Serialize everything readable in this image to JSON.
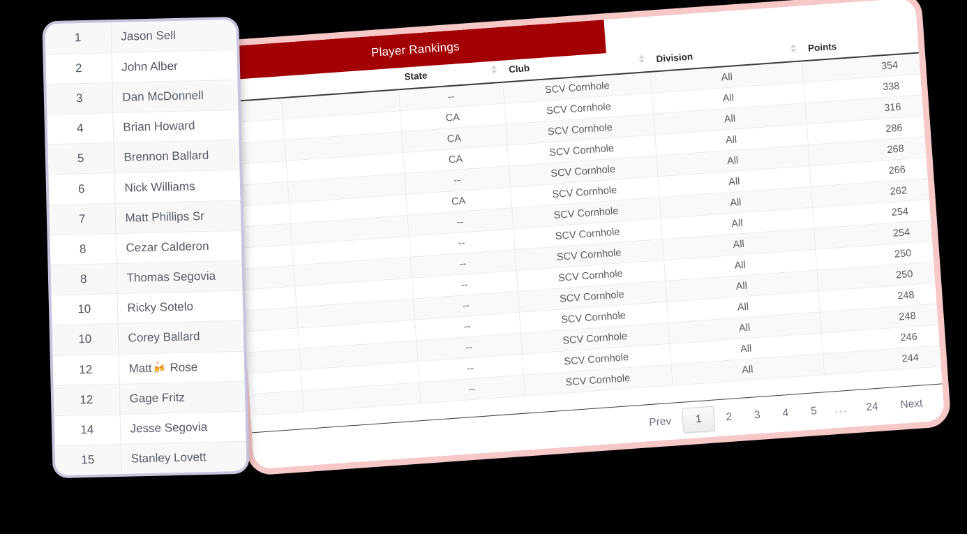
{
  "card": {
    "banner_title": "Player Rankings",
    "banner_color": "#a30004",
    "border_color": "#f7c8c8"
  },
  "table": {
    "headers": [
      {
        "key": "rank",
        "label": ""
      },
      {
        "key": "name",
        "label": ""
      },
      {
        "key": "state",
        "label": "State"
      },
      {
        "key": "club",
        "label": "Club"
      },
      {
        "key": "division",
        "label": "Division"
      },
      {
        "key": "points",
        "label": "Points"
      },
      {
        "key": "actions",
        "label": ""
      }
    ],
    "rows": [
      {
        "state": "--",
        "club": "SCV Cornhole",
        "division": "All",
        "points": "354",
        "action_icon": "tasks-icon"
      },
      {
        "state": "CA",
        "club": "SCV Cornhole",
        "division": "All",
        "points": "338",
        "action_icon": "tasks-icon"
      },
      {
        "state": "CA",
        "club": "SCV Cornhole",
        "division": "All",
        "points": "316",
        "action_icon": "tasks-icon"
      },
      {
        "state": "CA",
        "club": "SCV Cornhole",
        "division": "All",
        "points": "286",
        "action_icon": "tasks-icon"
      },
      {
        "state": "--",
        "club": "SCV Cornhole",
        "division": "All",
        "points": "268",
        "action_icon": "tasks-icon"
      },
      {
        "state": "CA",
        "club": "SCV Cornhole",
        "division": "All",
        "points": "266",
        "action_icon": "tasks-icon"
      },
      {
        "state": "--",
        "club": "SCV Cornhole",
        "division": "All",
        "points": "262",
        "action_icon": "tasks-icon"
      },
      {
        "state": "--",
        "club": "SCV Cornhole",
        "division": "All",
        "points": "254",
        "action_icon": "tasks-icon"
      },
      {
        "state": "--",
        "club": "SCV Cornhole",
        "division": "All",
        "points": "254",
        "action_icon": "tasks-icon"
      },
      {
        "state": "--",
        "club": "SCV Cornhole",
        "division": "All",
        "points": "250",
        "action_icon": "tasks-icon"
      },
      {
        "state": "--",
        "club": "SCV Cornhole",
        "division": "All",
        "points": "250",
        "action_icon": "tasks-icon"
      },
      {
        "state": "--",
        "club": "SCV Cornhole",
        "division": "All",
        "points": "248",
        "action_icon": "tasks-icon"
      },
      {
        "state": "--",
        "club": "SCV Cornhole",
        "division": "All",
        "points": "248",
        "action_icon": "tasks-icon"
      },
      {
        "state": "--",
        "club": "SCV Cornhole",
        "division": "All",
        "points": "246",
        "action_icon": "tasks-icon"
      },
      {
        "state": "--",
        "club": "SCV Cornhole",
        "division": "All",
        "points": "244",
        "action_icon": "tasks-icon"
      }
    ]
  },
  "pagination": {
    "prev_label": "Prev",
    "next_label": "Next",
    "ellipsis": "...",
    "pages": [
      "1",
      "2",
      "3",
      "4",
      "5"
    ],
    "last_page": "24",
    "active_page": "1"
  },
  "name_panel": {
    "border_color": "#c9c4de",
    "rows": [
      {
        "rank": "1",
        "name": "Jason Sell"
      },
      {
        "rank": "2",
        "name": "John Alber"
      },
      {
        "rank": "3",
        "name": "Dan McDonnell"
      },
      {
        "rank": "4",
        "name": "Brian Howard"
      },
      {
        "rank": "5",
        "name": "Brennon Ballard"
      },
      {
        "rank": "6",
        "name": "Nick Williams"
      },
      {
        "rank": "7",
        "name": "Matt Phillips Sr"
      },
      {
        "rank": "8",
        "name": "Cezar Calderon"
      },
      {
        "rank": "8",
        "name": "Thomas Segovia"
      },
      {
        "rank": "10",
        "name": "Ricky Sotelo"
      },
      {
        "rank": "10",
        "name": "Corey Ballard"
      },
      {
        "rank": "12",
        "name": "Matt🍻 Rose"
      },
      {
        "rank": "12",
        "name": "Gage Fritz"
      },
      {
        "rank": "14",
        "name": "Jesse Segovia"
      },
      {
        "rank": "15",
        "name": "Stanley Lovett"
      }
    ]
  }
}
